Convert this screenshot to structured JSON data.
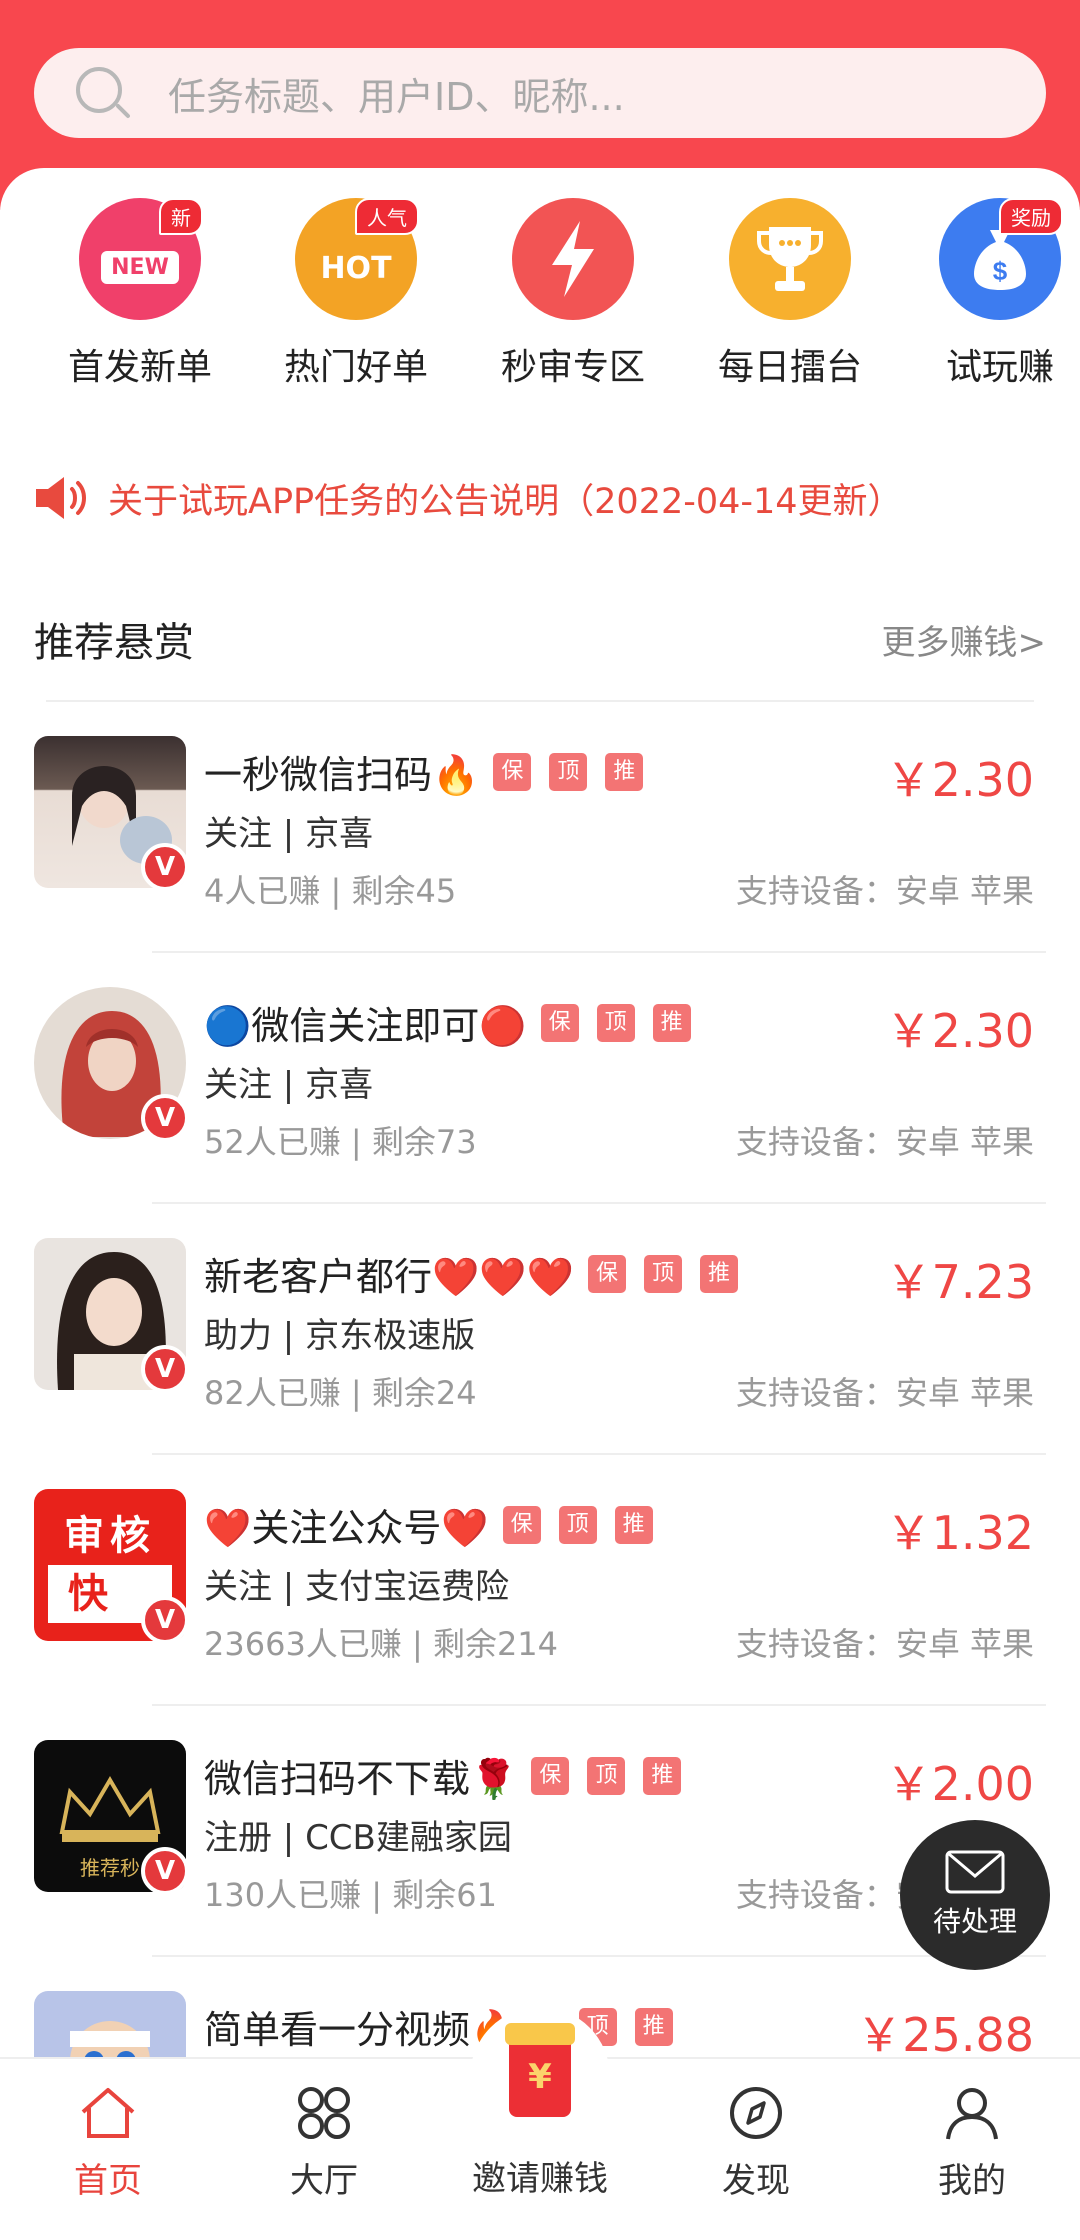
{
  "search": {
    "placeholder": "任务标题、用户ID、昵称..."
  },
  "categories": [
    {
      "label": "首发新单",
      "badge": "新",
      "inner": "NEW"
    },
    {
      "label": "热门好单",
      "badge": "人气",
      "inner": "HOT"
    },
    {
      "label": "秒审专区"
    },
    {
      "label": "每日擂台"
    },
    {
      "label": "试玩赚",
      "badge": "奖励"
    }
  ],
  "notice": {
    "text": "关于试玩APP任务的公告说明（2022-04-14更新）"
  },
  "section": {
    "title": "推荐悬赏",
    "more": "更多赚钱>"
  },
  "badge_v": "V",
  "tags": {
    "bao": "保",
    "ding": "顶",
    "tui": "推"
  },
  "avatar_text": {
    "shen": "审",
    "he": "核",
    "kuai": "快",
    "crown": "推荐秒"
  },
  "tasks": [
    {
      "title": "一秒微信扫码🔥",
      "price": "￥2.30",
      "category": "关注 | 京喜",
      "earned": "4人已赚 | ",
      "remaining": "剩余45",
      "devices": "支持设备：安卓 苹果"
    },
    {
      "title": "🔵微信关注即可🔴",
      "price": "￥2.30",
      "category": "关注 | 京喜",
      "earned": "52人已赚 | ",
      "remaining": "剩余73",
      "devices": "支持设备：安卓 苹果"
    },
    {
      "title": "新老客户都行❤️❤️❤️",
      "price": "￥7.23",
      "category": "助力 | 京东极速版",
      "earned": "82人已赚 | ",
      "remaining": "剩余24",
      "devices": "支持设备：安卓 苹果"
    },
    {
      "title": "❤️关注公众号❤️",
      "price": "￥1.32",
      "category": "关注 | 支付宝运费险",
      "earned": "23663人已赚 | ",
      "remaining": "剩余214",
      "devices": "支持设备：安卓 苹果"
    },
    {
      "title": "微信扫码不下载🌹",
      "price": "￥2.00",
      "category": "注册 | CCB建融家园",
      "earned": "130人已赚 | ",
      "remaining": "剩余61",
      "devices": "支持设备：安卓 苹果"
    },
    {
      "title": "简单看一分视频🔥🔥",
      "price": "￥25.88"
    }
  ],
  "fab": {
    "label": "待处理"
  },
  "tabs": [
    {
      "label": "首页"
    },
    {
      "label": "大厅"
    },
    {
      "label": "邀请赚钱",
      "symbol": "¥"
    },
    {
      "label": "发现"
    },
    {
      "label": "我的"
    }
  ],
  "colors": {
    "header": "#f8474e",
    "accent": "#ef4745",
    "tag": "#f37474",
    "fab": "#2b2b2b"
  }
}
